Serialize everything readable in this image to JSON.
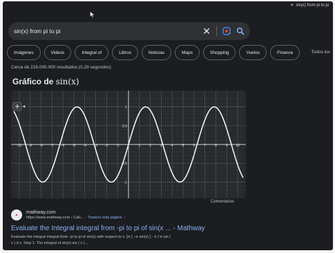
{
  "browser": {
    "tab_title": "sin(x) from pi to pi"
  },
  "search": {
    "query": "sin(x) from pi to pi"
  },
  "filters": [
    "Imágenes",
    "Videos",
    "Integral of",
    "Libros",
    "Noticias",
    "Maps",
    "Shopping",
    "Vuelos",
    "Finance"
  ],
  "tools": {
    "all_filters_label": "Todos los"
  },
  "results_info": "Cerca de 216.000.000 resultados (0,29 segundos)",
  "graph": {
    "title_prefix": "Gráfico de ",
    "title_math": "sin(x)",
    "comments_label": "Comentarios"
  },
  "chart_data": {
    "type": "line",
    "function": "sin(x)",
    "title": "Gráfico de sin(x)",
    "xlim": [
      -10.5,
      10.5
    ],
    "ylim": [
      -1.25,
      1.25
    ],
    "x_ticks": [
      -10,
      -9,
      -8,
      -7,
      -6,
      -5,
      -4,
      -3,
      -2,
      -1,
      0,
      1,
      2,
      3,
      4,
      5,
      6,
      7,
      8,
      9,
      10
    ],
    "x_tick_labels_shown": [
      -10,
      -9,
      -8,
      -7,
      -6,
      -5,
      -4,
      -3,
      -2,
      -1,
      1,
      2,
      3,
      4,
      5,
      6,
      7,
      8,
      9,
      10
    ],
    "y_tick_labels": [
      {
        "value": 1,
        "label": "1"
      },
      {
        "value": 0.5,
        "label": "0.5"
      },
      {
        "value": -0.5,
        "label": "-0.5"
      },
      {
        "value": -1,
        "label": "-1"
      }
    ],
    "grid": true,
    "series": [
      {
        "x": [
          -10,
          -9,
          -8,
          -7,
          -6,
          -5,
          -4,
          -3,
          -2,
          -1,
          0,
          1,
          2,
          3,
          4,
          5,
          6,
          7,
          8,
          9,
          10
        ],
        "y": [
          0.544,
          -0.412,
          -0.989,
          -0.657,
          0.279,
          0.959,
          0.757,
          -0.141,
          -0.909,
          -0.841,
          0,
          0.841,
          0.909,
          0.141,
          -0.757,
          -0.959,
          -0.279,
          0.657,
          0.989,
          0.412,
          -0.544
        ]
      }
    ]
  },
  "result": {
    "site_name": "mathway.com",
    "url": "https://www.mathway.com › Calc... ·",
    "translate_label": "Traducir esta página",
    "title": "Evaluate the Integral integral from -pi to pi of sin(x ... - Mathway",
    "snippet_line1": "Evaluate the integral integral from -pi to pi of sin(x) with respect to x. [π ∫ −π sin(x) ] · π ∫ π sin (",
    "snippet_line2": "x ) d x. Step 1. The integral of sin(x) sin ( x ) ..."
  },
  "colors": {
    "background": "#1c1d20",
    "link": "#8ab4f8",
    "text": "#e8eaed",
    "muted": "#bdc1c6"
  }
}
